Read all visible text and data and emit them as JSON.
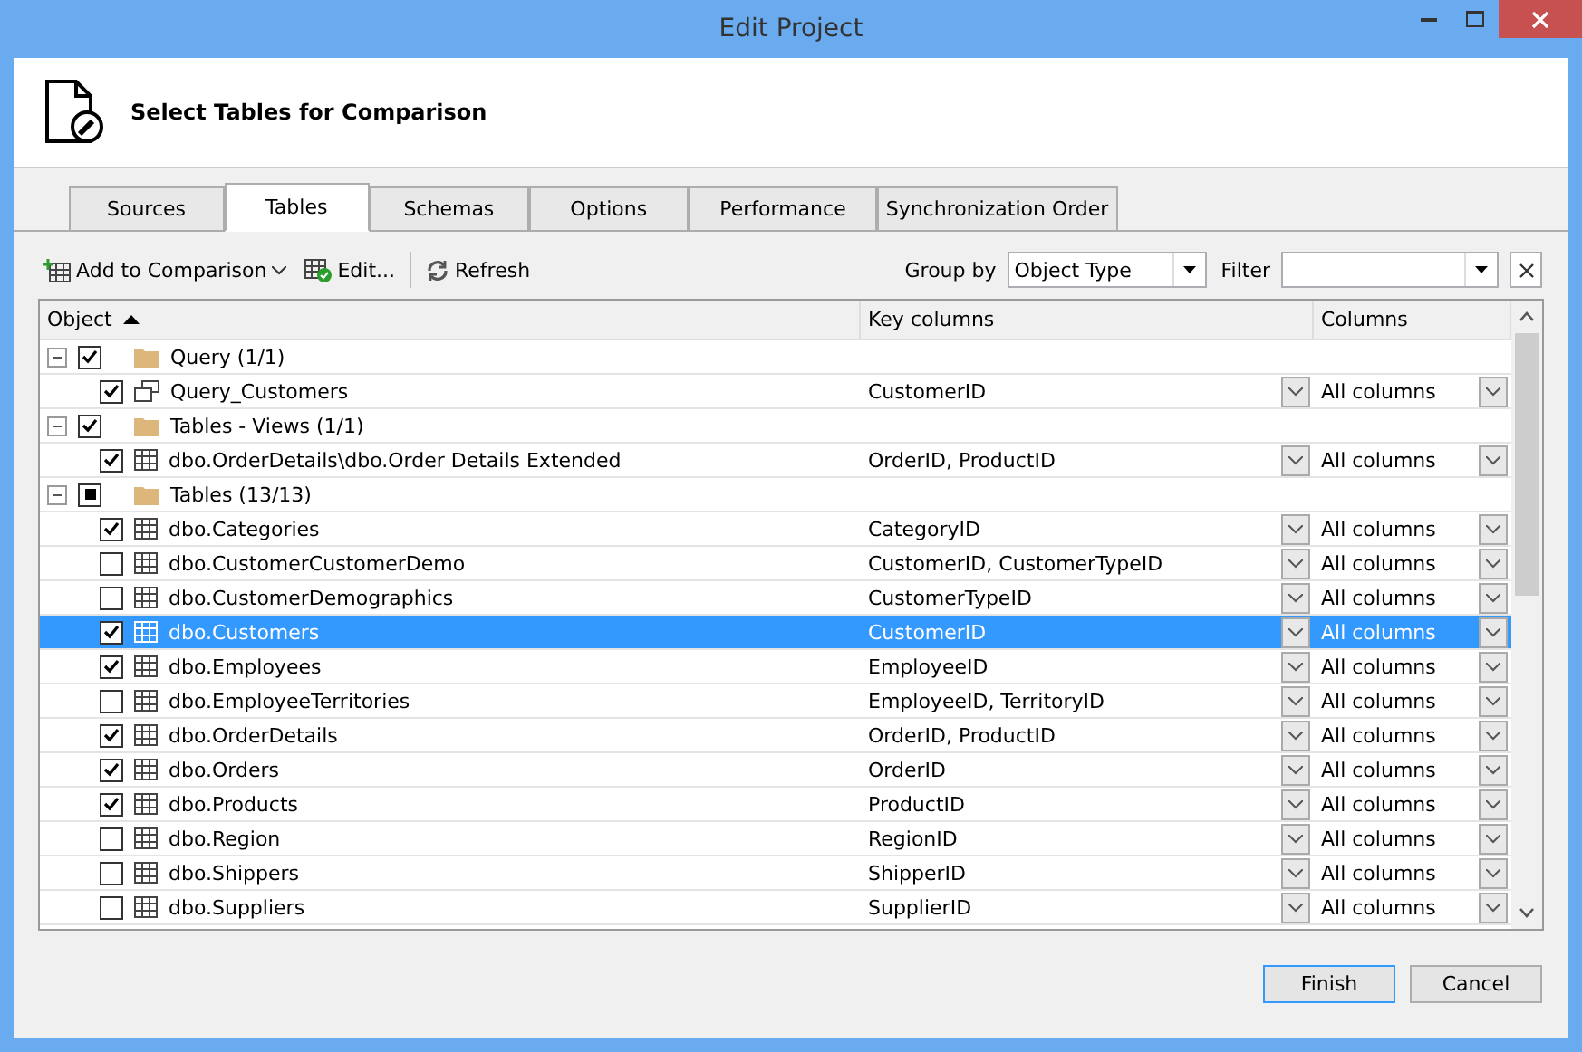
{
  "window": {
    "title": "Edit Project"
  },
  "header": {
    "title": "Select Tables for Comparison"
  },
  "tabs": [
    {
      "label": "Sources",
      "selected": false
    },
    {
      "label": "Tables",
      "selected": true
    },
    {
      "label": "Schemas",
      "selected": false
    },
    {
      "label": "Options",
      "selected": false
    },
    {
      "label": "Performance",
      "selected": false
    },
    {
      "label": "Synchronization Order",
      "selected": false
    }
  ],
  "toolbar": {
    "add_button": "Add to Comparison",
    "edit_button": "Edit...",
    "refresh_button": "Refresh",
    "group_by_label": "Group by",
    "group_by_value": "Object Type",
    "filter_label": "Filter"
  },
  "table": {
    "columns": [
      {
        "label": "Object",
        "sorted": true
      },
      {
        "label": "Key columns",
        "sorted": false
      },
      {
        "label": "Columns",
        "sorted": false
      }
    ],
    "groups": [
      {
        "label": "Query (1/1)",
        "expanded": true,
        "checked": true,
        "partial": false,
        "selected": false,
        "children": [
          {
            "kind": "query",
            "name": "Query_Customers",
            "key_columns": "CustomerID",
            "columns": "All columns",
            "checked": true,
            "selected": false
          }
        ]
      },
      {
        "label": "Tables - Views (1/1)",
        "expanded": true,
        "checked": true,
        "partial": false,
        "selected": false,
        "children": [
          {
            "kind": "table",
            "name": "dbo.OrderDetails\\dbo.Order Details Extended",
            "key_columns": "OrderID, ProductID",
            "columns": "All columns",
            "checked": true,
            "selected": false
          }
        ]
      },
      {
        "label": "Tables (13/13)",
        "expanded": true,
        "checked": false,
        "partial": true,
        "selected": false,
        "children": [
          {
            "kind": "table",
            "name": "dbo.Categories",
            "key_columns": "CategoryID",
            "columns": "All columns",
            "checked": true,
            "selected": false
          },
          {
            "kind": "table",
            "name": "dbo.CustomerCustomerDemo",
            "key_columns": "CustomerID, CustomerTypeID",
            "columns": "All columns",
            "checked": false,
            "selected": false
          },
          {
            "kind": "table",
            "name": "dbo.CustomerDemographics",
            "key_columns": "CustomerTypeID",
            "columns": "All columns",
            "checked": false,
            "selected": false
          },
          {
            "kind": "table",
            "name": "dbo.Customers",
            "key_columns": "CustomerID",
            "columns": "All columns",
            "checked": true,
            "selected": true
          },
          {
            "kind": "table",
            "name": "dbo.Employees",
            "key_columns": "EmployeeID",
            "columns": "All columns",
            "checked": true,
            "selected": false
          },
          {
            "kind": "table",
            "name": "dbo.EmployeeTerritories",
            "key_columns": "EmployeeID, TerritoryID",
            "columns": "All columns",
            "checked": false,
            "selected": false
          },
          {
            "kind": "table",
            "name": "dbo.OrderDetails",
            "key_columns": "OrderID, ProductID",
            "columns": "All columns",
            "checked": true,
            "selected": false
          },
          {
            "kind": "table",
            "name": "dbo.Orders",
            "key_columns": "OrderID",
            "columns": "All columns",
            "checked": true,
            "selected": false
          },
          {
            "kind": "table",
            "name": "dbo.Products",
            "key_columns": "ProductID",
            "columns": "All columns",
            "checked": true,
            "selected": false
          },
          {
            "kind": "table",
            "name": "dbo.Region",
            "key_columns": "RegionID",
            "columns": "All columns",
            "checked": false,
            "selected": false
          },
          {
            "kind": "table",
            "name": "dbo.Shippers",
            "key_columns": "ShipperID",
            "columns": "All columns",
            "checked": false,
            "selected": false
          },
          {
            "kind": "table",
            "name": "dbo.Suppliers",
            "key_columns": "SupplierID",
            "columns": "All columns",
            "checked": false,
            "selected": false
          }
        ]
      }
    ]
  },
  "buttons": [
    {
      "label": "Finish",
      "default": true
    },
    {
      "label": "Cancel",
      "default": false
    }
  ]
}
